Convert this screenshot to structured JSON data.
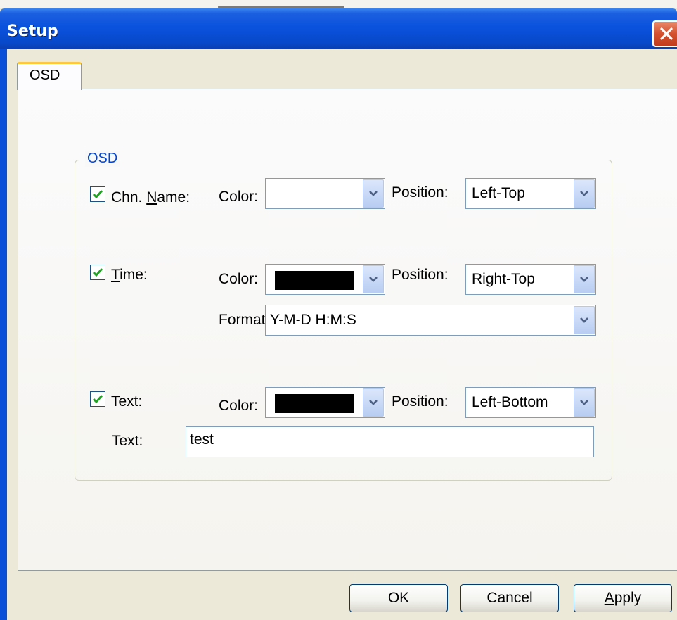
{
  "window": {
    "title": "Setup"
  },
  "tabs": [
    {
      "label": "OSD",
      "selected": true
    }
  ],
  "group": {
    "title": "OSD",
    "chn_name": {
      "checked": true,
      "label_pre": "Chn. ",
      "label_mnemonic": "N",
      "label_post": "ame:",
      "color_label": "Color:",
      "color_value": "#ffffff",
      "position_label": "Position:",
      "position_value": "Left-Top"
    },
    "time": {
      "checked": true,
      "label_mnemonic": "T",
      "label_post": "ime:",
      "color_label": "Color:",
      "color_value": "#000000",
      "position_label": "Position:",
      "position_value": "Right-Top",
      "format_label": "Format",
      "format_value": "Y-M-D H:M:S"
    },
    "text": {
      "checked": true,
      "label": "Text:",
      "color_label": "Color:",
      "color_value": "#000000",
      "position_label": "Position:",
      "position_value": "Left-Bottom",
      "text_label": "Text:",
      "text_value": "test"
    }
  },
  "buttons": {
    "ok": "OK",
    "cancel": "Cancel",
    "apply_mnemonic": "A",
    "apply_rest": "pply"
  },
  "colors": {
    "titlebar": "#0a52dd",
    "accent": "#0046d5",
    "check": "#21a121",
    "tab_highlight": "#ffc83c"
  }
}
